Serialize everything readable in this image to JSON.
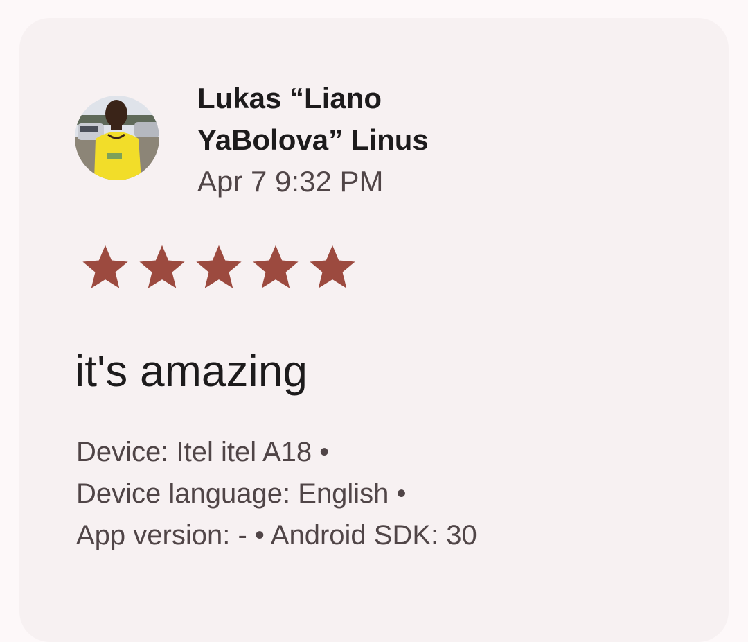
{
  "review": {
    "author_name": "Lukas “Liano YaBolova” Linus",
    "date": "Apr 7 9:32 PM",
    "rating": 5,
    "rating_max": 5,
    "text": "it's amazing",
    "details": {
      "line1": "Device: Itel itel A18 •",
      "line2": "Device language: English •",
      "line3": "App version: - • Android SDK: 30"
    }
  },
  "colors": {
    "star": "#9c4a3f",
    "card_background": "#f7f1f2",
    "page_background": "#fdf8f9",
    "primary_text": "#1d1b1c",
    "secondary_text": "#504547"
  },
  "icons": {
    "avatar": "user-photo-avatar",
    "star": "star-icon"
  }
}
